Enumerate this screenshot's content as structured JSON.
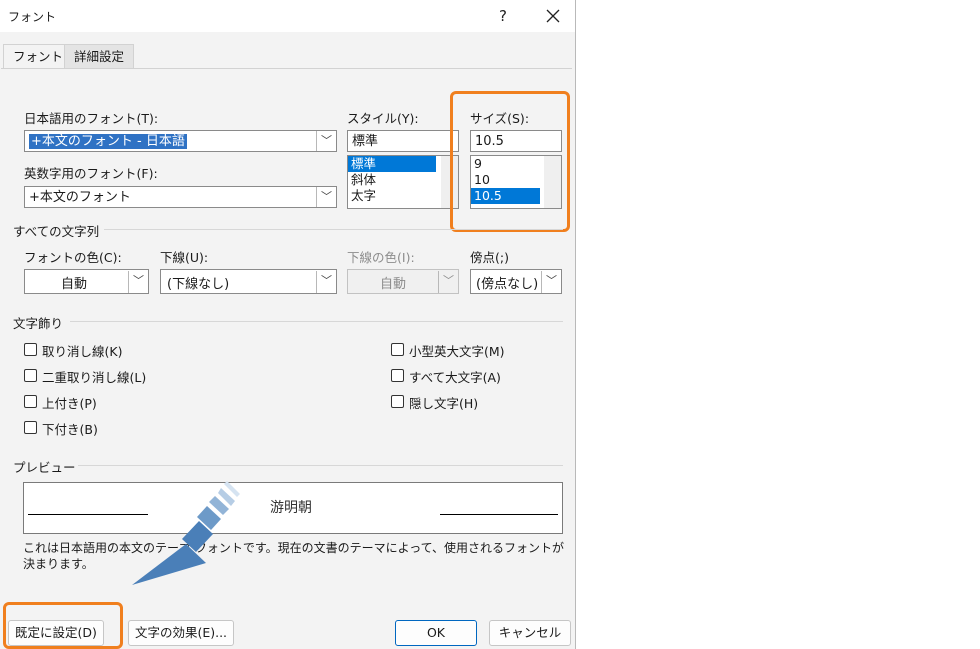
{
  "window": {
    "title": "フォント",
    "help_glyph": "?",
    "close_glyph": "✕"
  },
  "tabs": [
    {
      "label": "フォント",
      "active": true
    },
    {
      "label": "詳細設定",
      "active": false
    }
  ],
  "font": {
    "jp_label": "日本語用のフォント(T):",
    "jp_value": "+本文のフォント - 日本語",
    "en_label": "英数字用のフォント(F):",
    "en_value": "+本文のフォント"
  },
  "style": {
    "label": "スタイル(Y):",
    "value": "標準",
    "options": [
      "標準",
      "斜体",
      "太字"
    ],
    "selected_index": 0
  },
  "size": {
    "label": "サイズ(S):",
    "value": "10.5",
    "options": [
      "9",
      "10",
      "10.5"
    ],
    "selected_index": 2
  },
  "all_text": {
    "heading": "すべての文字列",
    "font_color_label": "フォントの色(C):",
    "font_color_value": "自動",
    "underline_label": "下線(U):",
    "underline_value": "(下線なし)",
    "underline_color_label": "下線の色(I):",
    "underline_color_value": "自動",
    "emphasis_label": "傍点(;)",
    "emphasis_value": "(傍点なし)"
  },
  "effects": {
    "heading": "文字飾り",
    "left": [
      "取り消し線(K)",
      "二重取り消し線(L)",
      "上付き(P)",
      "下付き(B)"
    ],
    "right": [
      "小型英大文字(M)",
      "すべて大文字(A)",
      "隠し文字(H)"
    ]
  },
  "preview": {
    "heading": "プレビュー",
    "sample": "游明朝",
    "note": "これは日本語用の本文のテーマ フォントです。現在の文書のテーマによって、使用されるフォントが決まります。"
  },
  "buttons": {
    "default": "既定に設定(D)",
    "text_effects": "文字の効果(E)...",
    "ok": "OK",
    "cancel": "キャンセル"
  },
  "icons": {
    "dropdown": "chevron-down-icon",
    "arrow": "annotation-arrow"
  },
  "colors": {
    "highlight_orange": "#f07f1e",
    "selection_blue": "#0078d7",
    "arrow_blue": "#4a7fb8"
  }
}
